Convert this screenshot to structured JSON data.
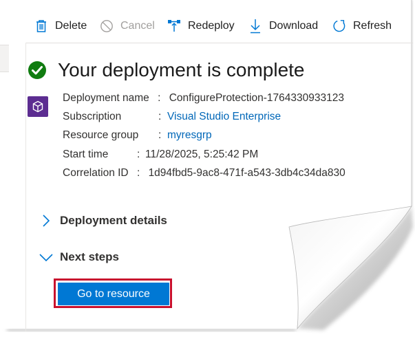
{
  "toolbar": {
    "delete_label": "Delete",
    "cancel_label": "Cancel",
    "redeploy_label": "Redeploy",
    "download_label": "Download",
    "refresh_label": "Refresh"
  },
  "status": {
    "title": "Your deployment is complete"
  },
  "details": {
    "deployment_name_label": "Deployment name",
    "deployment_name_value": "ConfigureProtection-1764330933123",
    "subscription_label": "Subscription",
    "subscription_value": "Visual Studio Enterprise",
    "resource_group_label": "Resource group",
    "resource_group_value": "myresgrp",
    "start_time_label": "Start time",
    "start_time_value": "11/28/2025, 5:25:42 PM",
    "correlation_id_label": "Correlation ID",
    "correlation_id_value": "1d94fbd5-9ac8-471f-a543-3db4c34da830",
    "separator": ":"
  },
  "sections": {
    "deployment_details": "Deployment details",
    "next_steps": "Next steps"
  },
  "actions": {
    "go_to_resource": "Go to resource"
  },
  "colors": {
    "accent": "#0078d4",
    "link": "#0067b8",
    "success": "#107c10",
    "highlight": "#c8102e",
    "resource_icon_bg": "#5c2d91"
  },
  "icons": {
    "delete": "trash-icon",
    "cancel": "cancel-circle-icon",
    "redeploy": "redeploy-icon",
    "download": "download-icon",
    "refresh": "refresh-icon",
    "status": "success-check-icon",
    "resource": "resource-cube-icon",
    "collapsed": "chevron-right-icon",
    "expanded": "chevron-down-icon"
  }
}
